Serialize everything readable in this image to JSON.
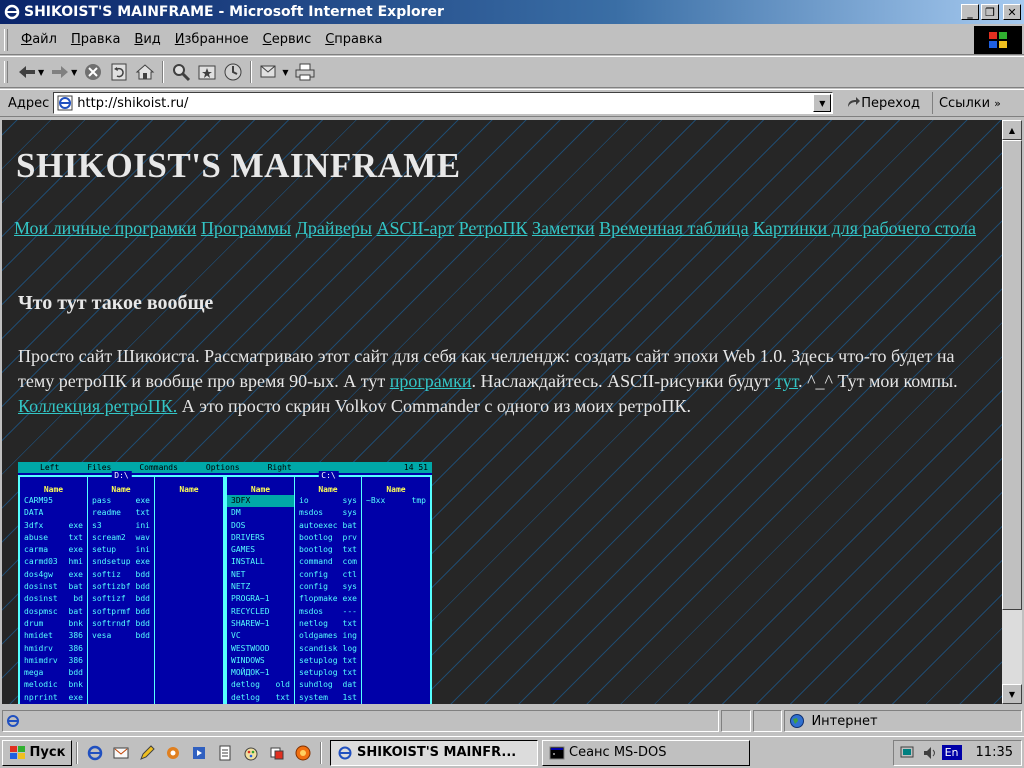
{
  "window": {
    "title": "SHIKOIST'S MAINFRAME - Microsoft Internet Explorer"
  },
  "menu": {
    "items": [
      {
        "hot": "Ф",
        "rest": "айл"
      },
      {
        "hot": "П",
        "rest": "равка"
      },
      {
        "hot": "В",
        "rest": "ид"
      },
      {
        "hot": "И",
        "rest": "збранное"
      },
      {
        "hot": "С",
        "rest": "ервис"
      },
      {
        "hot": "С",
        "rest": "правка"
      }
    ]
  },
  "address": {
    "label": "Адрес",
    "url": "http://shikoist.ru/",
    "go_label": "Переход",
    "links_label": "Ссылки"
  },
  "page": {
    "title": "SHIKOIST'S MAINFRAME",
    "nav": [
      "Мои личные програмки",
      "Программы",
      "Драйверы",
      "ASCII-арт",
      "РетроПК",
      "Заметки",
      "Временная таблица",
      "Картинки для рабочего стола"
    ],
    "heading": "Что тут такое вообще",
    "para": {
      "t1": "Просто сайт Шикоиста. Рассматриваю этот сайт для себя как челлендж: создать сайт эпохи Web 1.0. Здесь что-то будет на тему ретроПК и вообще про время 90-ых. А тут ",
      "l1": "програмки",
      "t2": ". Наслаждайтесь. ASCII-рисунки будут ",
      "l2": "тут",
      "t3": ". ^_^ Тут мои компы. ",
      "l3": "Коллекция ретроПК.",
      "t4": " А это просто скрин Volkov Commander с одного из моих ретроПК."
    }
  },
  "vc": {
    "menu": [
      "Left",
      "Files",
      "Commands",
      "Options",
      "Right"
    ],
    "clock": "14 51",
    "left_path": "D:\\",
    "right_path": "C:\\",
    "col_header": "Name",
    "left_col1": [
      [
        "CARM95",
        ""
      ],
      [
        "DATA",
        ""
      ],
      [
        "3dfx",
        "exe"
      ],
      [
        "abuse",
        "txt"
      ],
      [
        "carma",
        "exe"
      ],
      [
        "carmd03",
        "hmi"
      ],
      [
        "dos4gw",
        "exe"
      ],
      [
        "dosinst",
        "bat"
      ],
      [
        "dosinst",
        "bd"
      ],
      [
        "dospmsc",
        "bat"
      ],
      [
        "drum",
        "bnk"
      ],
      [
        "hmidet",
        "386"
      ],
      [
        "hmidrv",
        "386"
      ],
      [
        "hmimdrv",
        "386"
      ],
      [
        "mega",
        "bdd"
      ],
      [
        "melodic",
        "bnk"
      ],
      [
        "nprrint",
        "exe"
      ]
    ],
    "left_col2": [
      [
        "pass",
        "exe"
      ],
      [
        "readme",
        "txt"
      ],
      [
        "s3",
        "ini"
      ],
      [
        "scream2",
        "wav"
      ],
      [
        "setup",
        "ini"
      ],
      [
        "sndsetup",
        "exe"
      ],
      [
        "softiz",
        "bdd"
      ],
      [
        "softizbf",
        "bdd"
      ],
      [
        "softizf",
        "bdd"
      ],
      [
        "softprmf",
        "bdd"
      ],
      [
        "softrndf",
        "bdd"
      ],
      [
        "vesa",
        "bdd"
      ]
    ],
    "right_col1": [
      [
        "3DFX",
        ""
      ],
      [
        "DM",
        ""
      ],
      [
        "DOS",
        ""
      ],
      [
        "DRIVERS",
        ""
      ],
      [
        "GAMES",
        ""
      ],
      [
        "INSTALL",
        ""
      ],
      [
        "NET",
        ""
      ],
      [
        "NETZ",
        ""
      ],
      [
        "PROGRA~1",
        ""
      ],
      [
        "RECYCLED",
        ""
      ],
      [
        "SHAREW~1",
        ""
      ],
      [
        "VC",
        ""
      ],
      [
        "WESTWOOD",
        ""
      ],
      [
        "WINDOWS",
        ""
      ],
      [
        "МОЙДОК~1",
        ""
      ],
      [
        "detlog",
        "old"
      ],
      [
        "detlog",
        "txt"
      ]
    ],
    "right_col2": [
      [
        "io",
        "sys"
      ],
      [
        "msdos",
        "sys"
      ],
      [
        "autoexec",
        "bat"
      ],
      [
        "bootlog",
        "prv"
      ],
      [
        "bootlog",
        "txt"
      ],
      [
        "command",
        "com"
      ],
      [
        "config",
        "ctl"
      ],
      [
        "config",
        "sys"
      ],
      [
        "flopmake",
        "exe"
      ],
      [
        "msdos",
        "---"
      ],
      [
        "netlog",
        "txt"
      ],
      [
        "oldgames",
        "ing"
      ],
      [
        "scandisk",
        "log"
      ],
      [
        "setuplog",
        "txt"
      ],
      [
        "setuplog",
        "txt"
      ],
      [
        "suhdlog",
        "dat"
      ],
      [
        "system",
        "1st"
      ]
    ],
    "right_col3": [
      [
        "~Bxx",
        "tmp"
      ]
    ]
  },
  "status": {
    "zone": "Интернет"
  },
  "taskbar": {
    "start": "Пуск",
    "tasks": [
      "SHIKOIST'S MAINFR...",
      "Сеанс MS-DOS"
    ],
    "lang": "En",
    "clock": "11:35"
  }
}
